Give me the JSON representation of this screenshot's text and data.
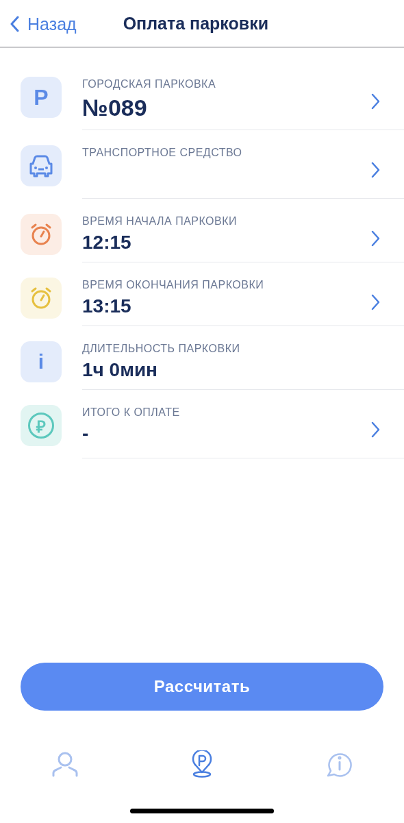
{
  "nav": {
    "back": "Назад",
    "title": "Оплата парковки"
  },
  "rows": [
    {
      "kind": "parking",
      "icon_text": "P",
      "label": "ГОРОДСКАЯ ПАРКОВКА",
      "value": "№089",
      "disclosure": true
    },
    {
      "kind": "car",
      "label": "ТРАНСПОРТНОЕ СРЕДСТВО",
      "disclosure": true
    },
    {
      "kind": "clock",
      "color": "#e8834f",
      "label": "ВРЕМЯ НАЧАЛА ПАРКОВКИ",
      "value": "12:15",
      "disclosure": true
    },
    {
      "kind": "clock",
      "color": "#e6c040",
      "label": "ВРЕМЯ ОКОНЧАНИЯ ПАРКОВКИ",
      "value": "13:15",
      "disclosure": true
    },
    {
      "kind": "info",
      "icon_text": "i",
      "label": "ДЛИТЕЛЬНОСТЬ ПАРКОВКИ",
      "value": "1ч 0мин",
      "disclosure": false
    },
    {
      "kind": "ruble",
      "icon_text": "₽",
      "label": "ИТОГО К ОПЛАТЕ",
      "value": "-",
      "disclosure": true
    }
  ],
  "button": "Рассчитать",
  "tabs": [
    {
      "kind": "profile",
      "selected": false
    },
    {
      "kind": "parking",
      "selected": true
    },
    {
      "kind": "info",
      "selected": false
    }
  ]
}
